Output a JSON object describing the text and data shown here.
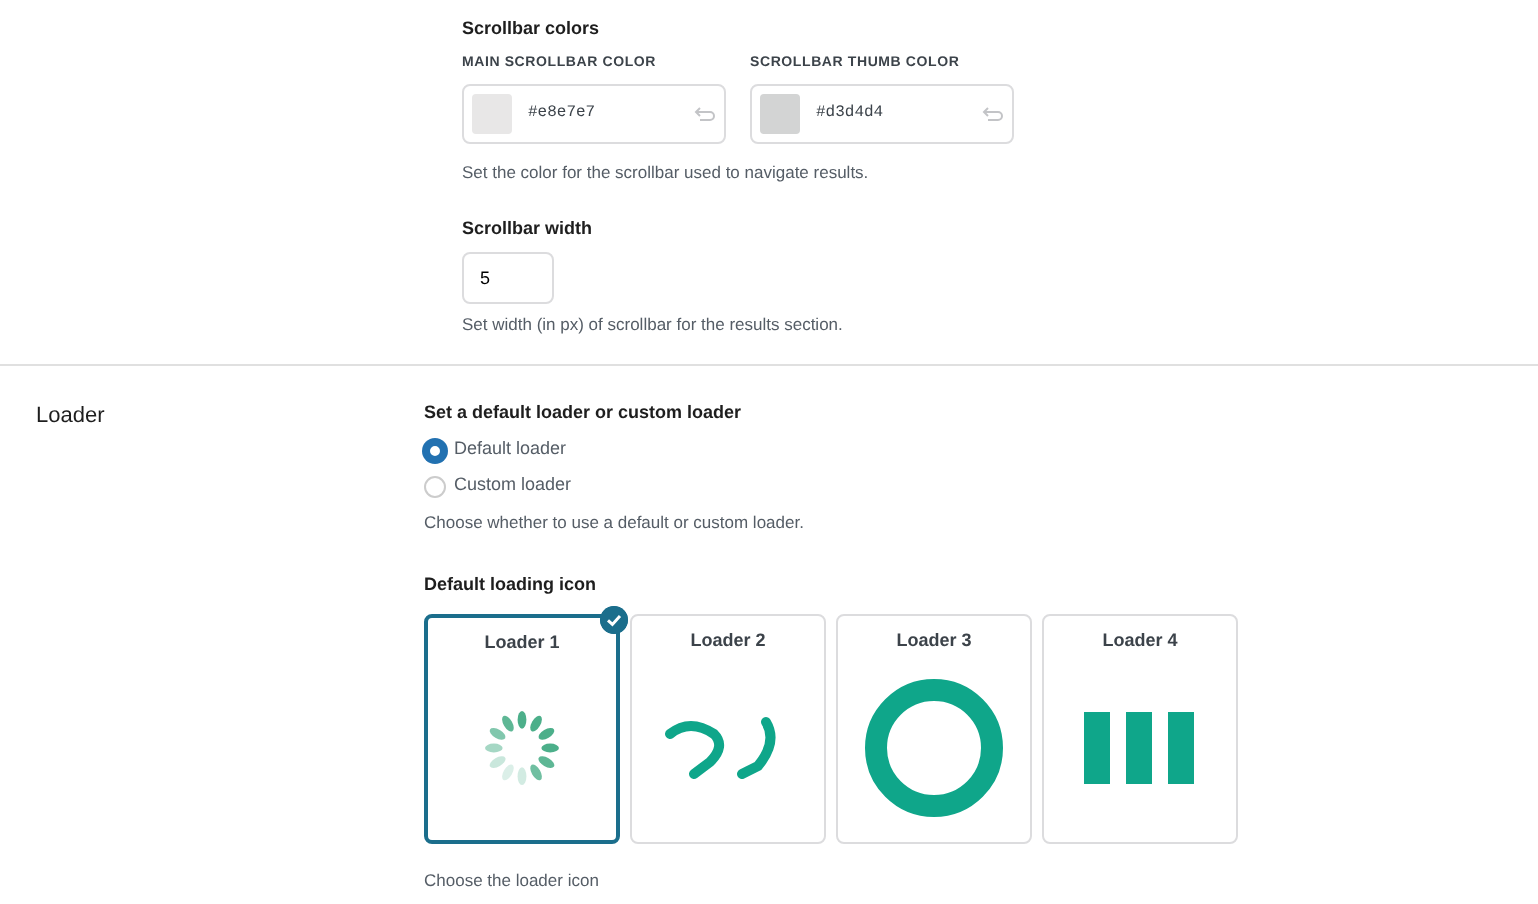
{
  "scrollbar_colors": {
    "title": "Scrollbar colors",
    "fields": [
      {
        "label": "MAIN SCROLLBAR COLOR",
        "value": "#e8e7e7",
        "color": "#e8e7e7"
      },
      {
        "label": "SCROLLBAR THUMB COLOR",
        "value": "#d3d4d4",
        "color": "#d3d4d4"
      }
    ],
    "help": "Set the color for the scrollbar used to navigate results."
  },
  "scrollbar_width": {
    "title": "Scrollbar width",
    "value": "5",
    "help": "Set width (in px) of scrollbar for the results section."
  },
  "loader": {
    "section": "Loader",
    "title": "Set a default loader or custom loader",
    "options": [
      {
        "label": "Default loader",
        "selected": true
      },
      {
        "label": "Custom loader",
        "selected": false
      }
    ],
    "help": "Choose whether to use a default or custom loader.",
    "icon_title": "Default loading icon",
    "icons": [
      {
        "label": "Loader 1",
        "kind": "spinner",
        "selected": true
      },
      {
        "label": "Loader 2",
        "kind": "arrows",
        "selected": false
      },
      {
        "label": "Loader 3",
        "kind": "ring",
        "selected": false
      },
      {
        "label": "Loader 4",
        "kind": "bars",
        "selected": false
      }
    ],
    "icon_help": "Choose the loader icon"
  }
}
